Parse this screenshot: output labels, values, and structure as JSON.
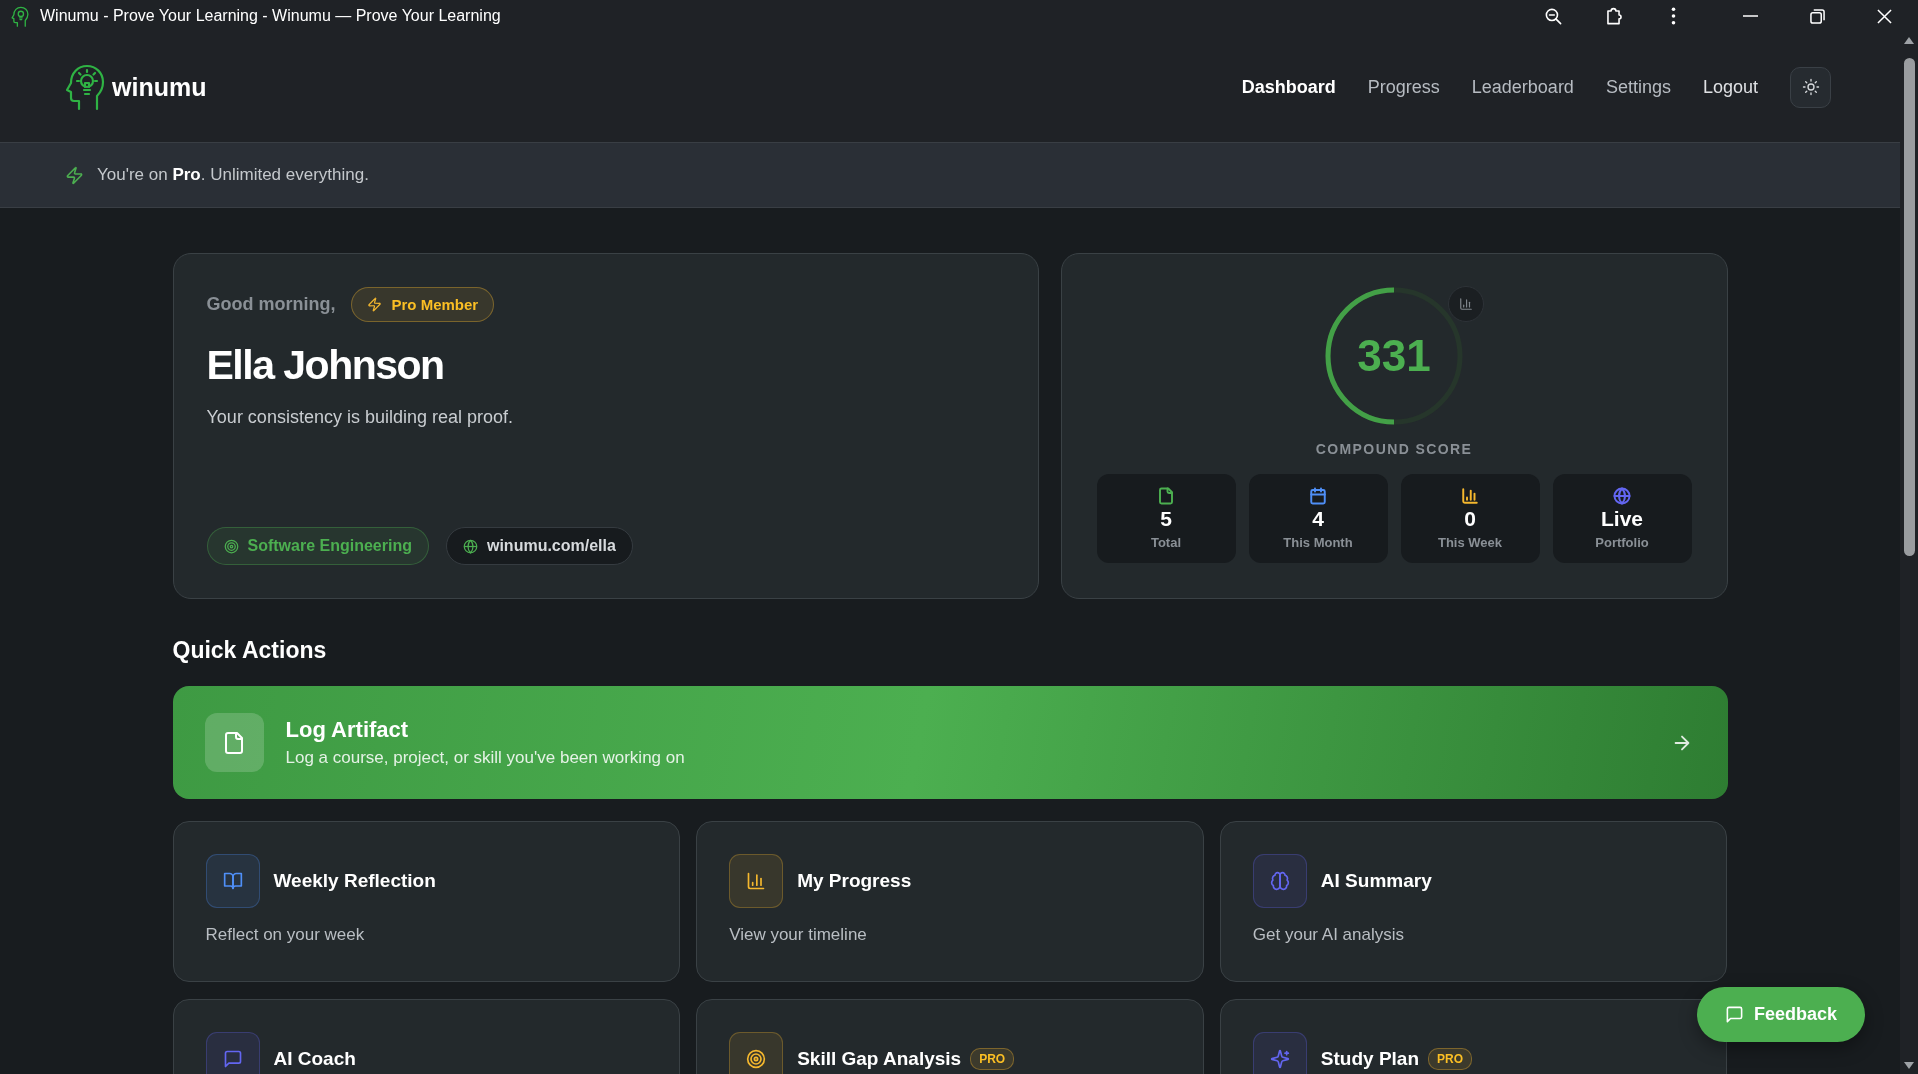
{
  "window": {
    "title": "Winumu - Prove Your Learning - Winumu — Prove Your Learning"
  },
  "header": {
    "brand": "winumu",
    "nav": [
      {
        "label": "Dashboard",
        "selected": true
      },
      {
        "label": "Progress",
        "selected": false
      },
      {
        "label": "Leaderboard",
        "selected": false
      },
      {
        "label": "Settings",
        "selected": false
      }
    ],
    "logout": "Logout"
  },
  "banner": {
    "text": "You're on **Pro**. Unlimited everything."
  },
  "profile": {
    "greeting": "Good morning,",
    "badge": "Pro Member",
    "name": "Ella Johnson",
    "tagline": "Your consistency is building real proof.",
    "chips": [
      {
        "kind": "tag",
        "label": "Software Engineering"
      },
      {
        "kind": "link",
        "label": "winumu.com/ella"
      }
    ]
  },
  "score": {
    "value": "331",
    "level": 0.5,
    "label": "COMPOUND SCORE",
    "stats": [
      {
        "kind": "file",
        "value": "5",
        "label": "Total",
        "color": "#4caf50"
      },
      {
        "kind": "calendar",
        "value": "4",
        "label": "This Month",
        "color": "#4f8ff7"
      },
      {
        "kind": "chart",
        "value": "0",
        "label": "This Week",
        "color": "#f5b82e"
      },
      {
        "kind": "globe",
        "value": "Live",
        "label": "Portfolio",
        "color": "#6366f1"
      }
    ]
  },
  "quick_actions": {
    "title": "Quick Actions",
    "primary": {
      "title": "Log Artifact",
      "description": "Log a course, project, or skill you've been working on"
    },
    "cards": [
      {
        "kind": "book",
        "title": "Weekly Reflection",
        "description": "Reflect on your week",
        "color": "#4f8ff7"
      },
      {
        "kind": "chart",
        "title": "My Progress",
        "description": "View your timeline",
        "color": "#f5b82e"
      },
      {
        "kind": "brain",
        "title": "AI Summary",
        "description": "Get your AI analysis",
        "color": "#6366f1"
      },
      {
        "kind": "message",
        "title": "AI Coach",
        "color": "#6366f1"
      },
      {
        "kind": "target",
        "title": "Skill Gap Analysis",
        "badge": "PRO",
        "color": "#f5b82e"
      },
      {
        "kind": "sparkles",
        "title": "Study Plan",
        "badge": "PRO",
        "color": "#6366f1"
      }
    ]
  },
  "feedback": {
    "label": "Feedback"
  }
}
